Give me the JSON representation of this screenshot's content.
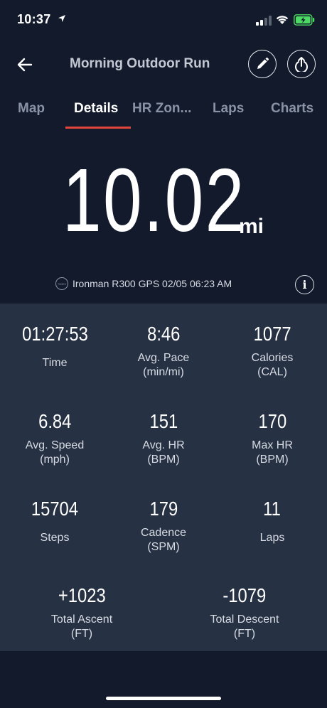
{
  "status_bar": {
    "time": "10:37"
  },
  "header": {
    "title": "Morning Outdoor Run"
  },
  "tabs": [
    {
      "label": "Map",
      "active": false
    },
    {
      "label": "Details",
      "active": true
    },
    {
      "label": "HR Zon...",
      "active": false
    },
    {
      "label": "Laps",
      "active": false
    },
    {
      "label": "Charts",
      "active": false
    }
  ],
  "distance": {
    "value": "10.02",
    "unit": "mi"
  },
  "device": {
    "logo_text": "TIMEX",
    "text": "Ironman R300 GPS 02/05 06:23 AM"
  },
  "stats": [
    {
      "value": "01:27:53",
      "label": "Time",
      "sub": ""
    },
    {
      "value": "8:46",
      "label": "Avg. Pace",
      "sub": "(min/mi)"
    },
    {
      "value": "1077",
      "label": "Calories",
      "sub": "(CAL)"
    },
    {
      "value": "6.84",
      "label": "Avg. Speed",
      "sub": "(mph)"
    },
    {
      "value": "151",
      "label": "Avg. HR",
      "sub": "(BPM)"
    },
    {
      "value": "170",
      "label": "Max HR",
      "sub": "(BPM)"
    },
    {
      "value": "15704",
      "label": "Steps",
      "sub": ""
    },
    {
      "value": "179",
      "label": "Cadence",
      "sub": "(SPM)"
    },
    {
      "value": "11",
      "label": "Laps",
      "sub": ""
    },
    {
      "value": "+1023",
      "label": "Total Ascent",
      "sub": "(FT)"
    },
    {
      "value": "-1079",
      "label": "Total Descent",
      "sub": "(FT)"
    }
  ],
  "colors": {
    "background": "#121a2c",
    "panel": "#263143",
    "accent": "#e2463a",
    "battery": "#4cd964"
  },
  "icons": [
    "location-arrow-icon",
    "signal-icon",
    "wifi-icon",
    "battery-icon",
    "back-arrow-icon",
    "pencil-icon",
    "share-icon",
    "timex-logo-icon",
    "info-icon"
  ]
}
